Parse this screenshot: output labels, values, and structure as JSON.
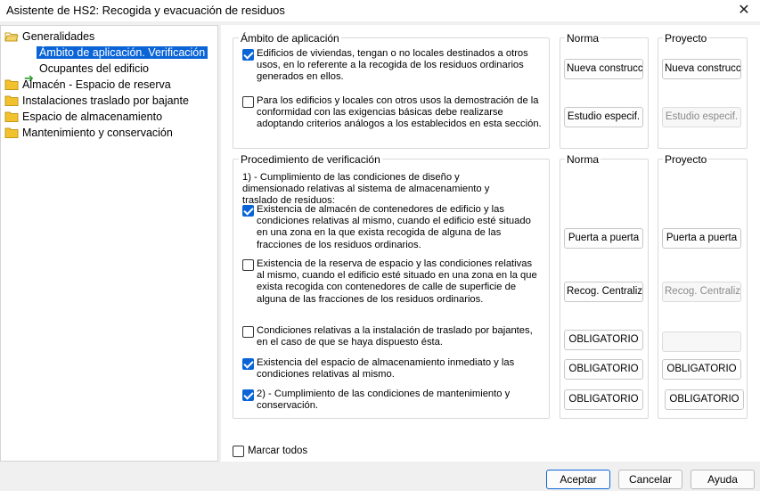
{
  "window": {
    "title": "Asistente de HS2: Recogida y evacuación de residuos",
    "close": "✕"
  },
  "tree": {
    "items": [
      {
        "label": "Generalidades",
        "icon": "folder-open-icon"
      },
      {
        "label": "Ámbito de aplicación. Verificación",
        "selected": true,
        "icon": "arrow-right-icon"
      },
      {
        "label": "Ocupantes del edificio"
      },
      {
        "label": "Almacén - Espacio de reserva",
        "icon": "folder-icon"
      },
      {
        "label": "Instalaciones traslado por bajante",
        "icon": "folder-icon"
      },
      {
        "label": "Espacio de almacenamiento",
        "icon": "folder-icon"
      },
      {
        "label": "Mantenimiento y conservación",
        "icon": "folder-icon"
      }
    ]
  },
  "ambito": {
    "title": "Ámbito de aplicación",
    "norma_title": "Norma",
    "proyecto_title": "Proyecto",
    "rows": [
      {
        "checked": true,
        "text": "Edificios de viviendas, tengan o no locales destinados a otros usos, en lo referente a la recogida de los residuos ordinarios generados en ellos.",
        "norma": "Nueva construcc",
        "proyecto": "Nueva construcc",
        "proyecto_disabled": false
      },
      {
        "checked": false,
        "text": "Para los edificios y locales con otros usos la demostración de la conformidad con las exigencias básicas debe realizarse adoptando criterios análogos a los establecidos en esta sección.",
        "norma": "Estudio especif.",
        "proyecto": "Estudio especif.",
        "proyecto_disabled": true
      }
    ]
  },
  "procedimiento": {
    "title": "Procedimiento de verificación",
    "norma_title": "Norma",
    "proyecto_title": "Proyecto",
    "intro": "1) - Cumplimiento de las condiciones de diseño y dimensionado relativas al sistema de almacenamiento y traslado de residuos:",
    "rows": [
      {
        "checked": true,
        "text": "Existencia de almacén de contenedores de edificio y las condiciones relativas al mismo, cuando el edificio esté situado en una zona en la que exista recogida de alguna de las fracciones de los residuos ordinarios.",
        "norma": "Puerta a puerta",
        "proyecto": "Puerta a puerta",
        "proyecto_disabled": false
      },
      {
        "checked": false,
        "text": "Existencia de la reserva de espacio y las condiciones relativas al mismo, cuando el edificio esté situado en una zona en la que exista recogida con contenedores de calle de superficie de alguna de las fracciones de los residuos ordinarios.",
        "norma": "Recog. Centraliz.",
        "proyecto": "Recog. Centraliz.",
        "proyecto_disabled": true
      },
      {
        "checked": false,
        "text": "Condiciones relativas a la instalación de traslado por bajantes, en el caso de que se haya dispuesto ésta.",
        "norma": "OBLIGATORIO",
        "proyecto": "",
        "proyecto_disabled": true
      },
      {
        "checked": true,
        "text": "Existencia del espacio de almacenamiento inmediato y las condiciones relativas al mismo.",
        "norma": "OBLIGATORIO",
        "proyecto": "OBLIGATORIO",
        "proyecto_disabled": false
      },
      {
        "checked": true,
        "text": "2) - Cumplimiento de las condiciones de mantenimiento y conservación.",
        "norma": "OBLIGATORIO",
        "proyecto": "OBLIGATORIO",
        "proyecto_disabled": false
      }
    ]
  },
  "marcar_todos": {
    "label": "Marcar todos",
    "checked": false
  },
  "buttons": {
    "accept": "Aceptar",
    "cancel": "Cancelar",
    "help": "Ayuda"
  },
  "colors": {
    "accent": "#0a64d6",
    "folder": "#f2c12e"
  }
}
